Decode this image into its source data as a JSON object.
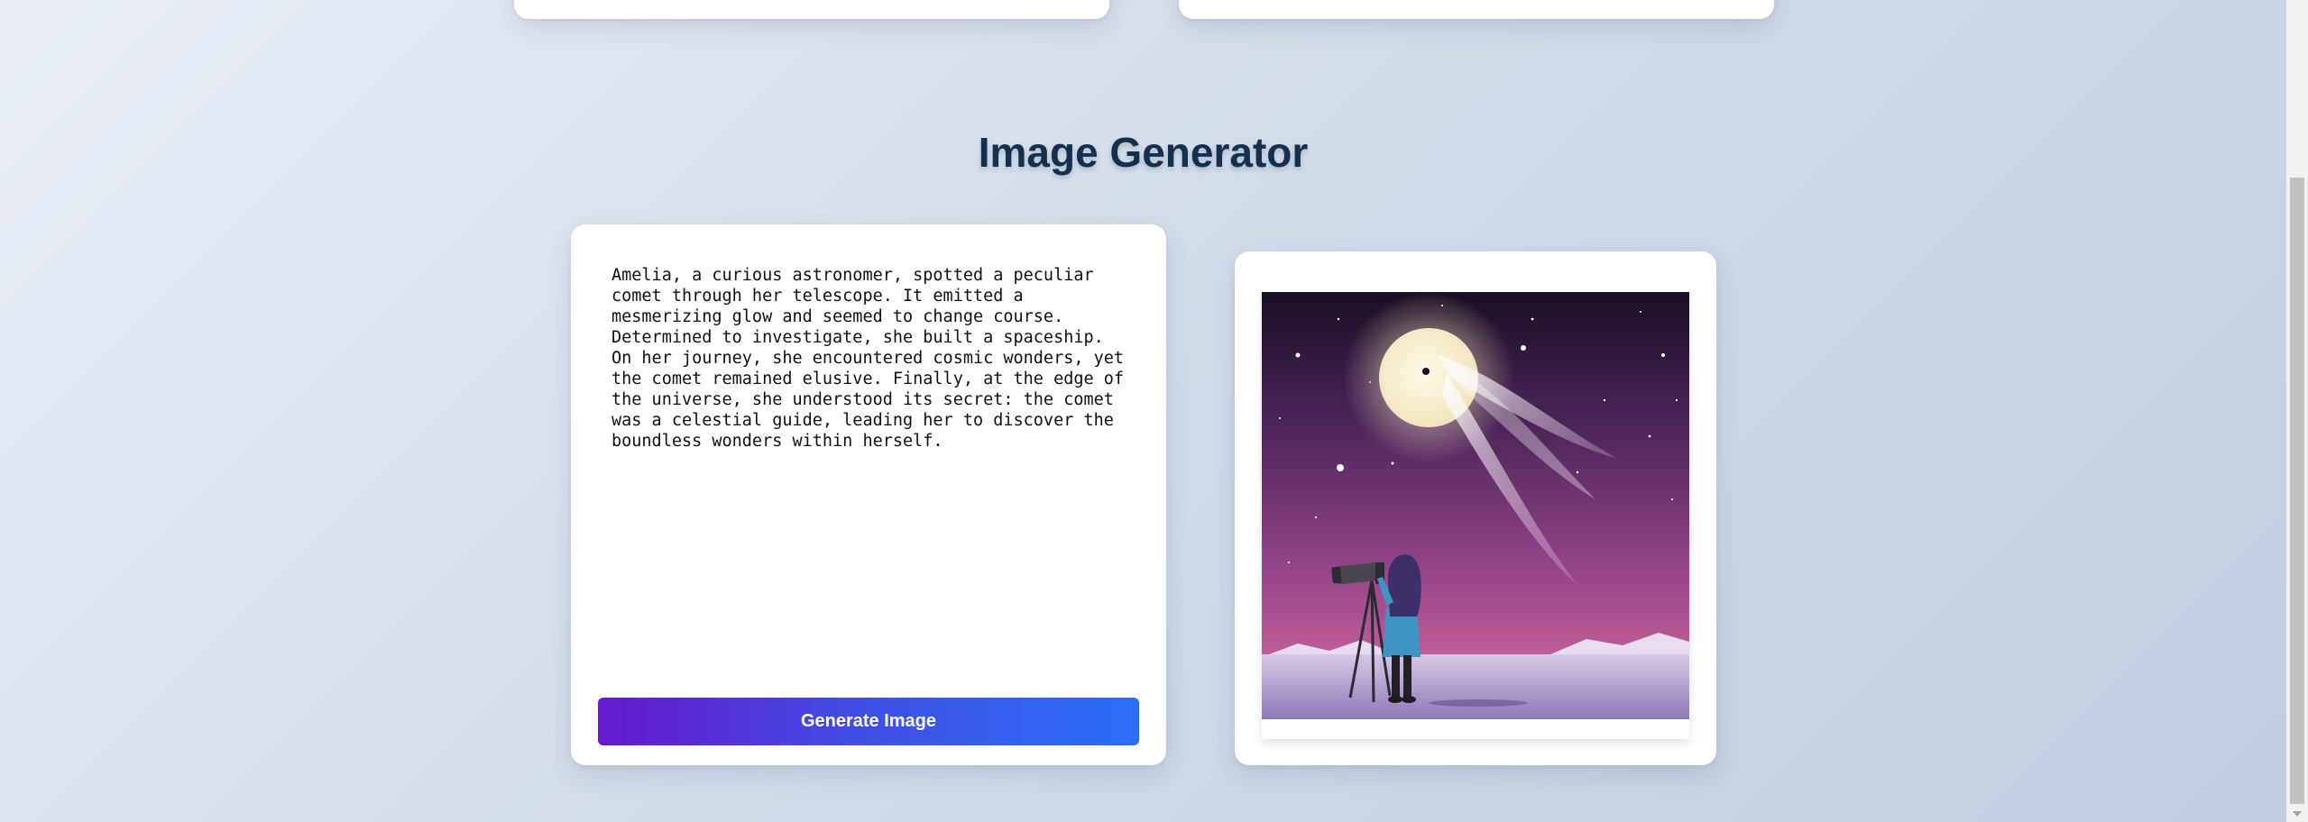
{
  "page": {
    "section_title": "Image Generator"
  },
  "generator": {
    "prompt_text": "Amelia, a curious astronomer, spotted a peculiar comet through her telescope. It emitted a mesmerizing glow and seemed to change course. Determined to investigate, she built a spaceship. On her journey, she encountered cosmic wonders, yet the comet remained elusive. Finally, at the edge of the universe, she understood its secret: the comet was a celestial guide, leading her to discover the boundless wonders within herself.",
    "generate_button_label": "Generate Image"
  },
  "output": {
    "image_subject": "girl with telescope watching comet in purple night sky"
  },
  "theme": {
    "title_color": "#15304f",
    "button_gradient_start": "#6419d0",
    "button_gradient_end": "#2a6ef9",
    "card_background": "#ffffff"
  },
  "icons": {
    "scroll_down": "chevron-down-icon"
  }
}
